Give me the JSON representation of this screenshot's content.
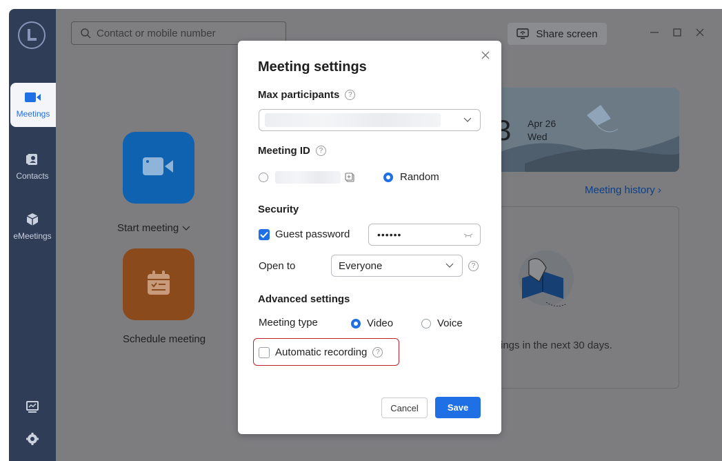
{
  "sidebar": {
    "items": [
      {
        "label": "Meetings"
      },
      {
        "label": "Contacts"
      },
      {
        "label": "eMeetings"
      }
    ]
  },
  "header": {
    "search_placeholder": "Contact or mobile number",
    "share_screen": "Share screen"
  },
  "home": {
    "start_meeting": "Start meeting",
    "schedule_meeting": "Schedule meeting",
    "date_day_partial": "3",
    "date_month_day": "Apr 26",
    "date_weekday": "Wed",
    "meeting_history": "Meeting history",
    "empty_text": "ings in the next 30 days."
  },
  "dialog": {
    "title": "Meeting settings",
    "max_participants_label": "Max participants",
    "meeting_id_label": "Meeting ID",
    "random_label": "Random",
    "security_label": "Security",
    "guest_password_label": "Guest password",
    "guest_password_value": "••••••",
    "guest_password_checked": true,
    "open_to_label": "Open to",
    "open_to_value": "Everyone",
    "advanced_label": "Advanced settings",
    "meeting_type_label": "Meeting type",
    "meeting_type_options": [
      "Video",
      "Voice"
    ],
    "meeting_type_selected": "Video",
    "auto_recording_label": "Automatic recording",
    "auto_recording_checked": false,
    "cancel": "Cancel",
    "save": "Save"
  },
  "colors": {
    "accent": "#1f6fe5",
    "sidebar": "#2f3d57",
    "highlight_border": "#c0232c"
  }
}
